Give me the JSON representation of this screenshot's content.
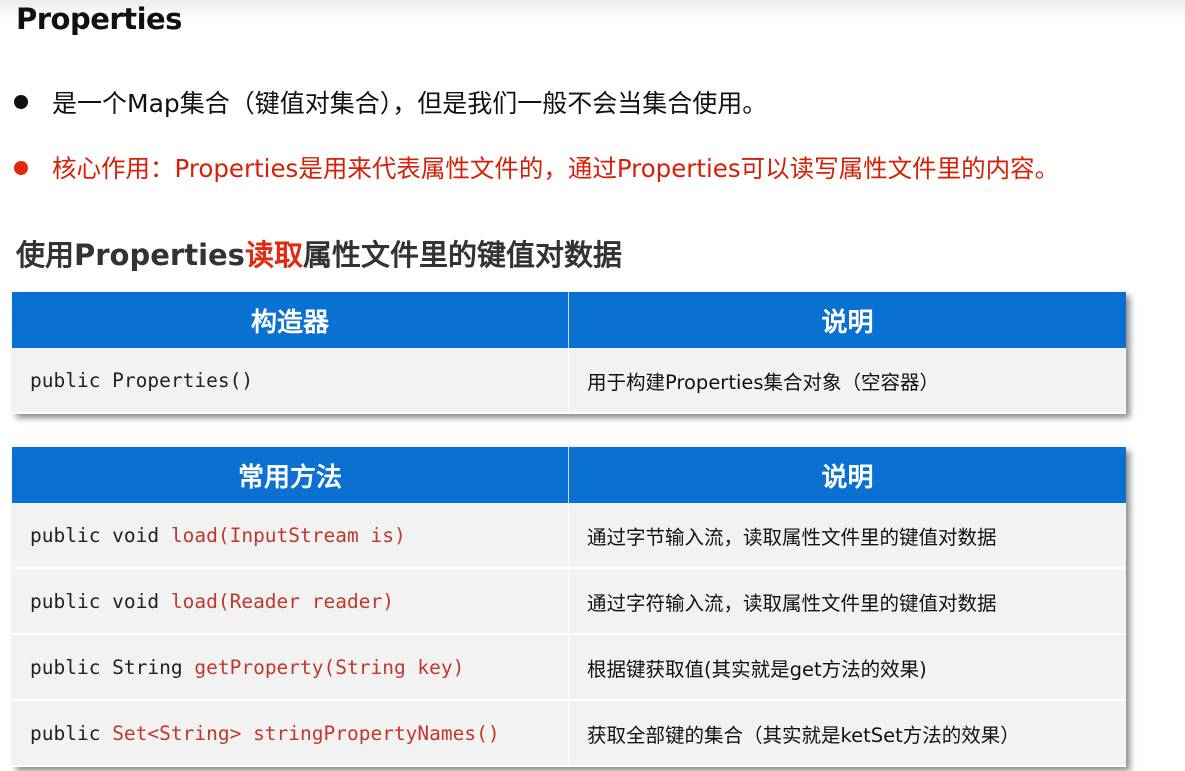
{
  "title": "Properties",
  "bullets": [
    "是一个Map集合（键值对集合），但是我们一般不会当集合使用。",
    "核心作用：Properties是用来代表属性文件的，通过Properties可以读写属性文件里的内容。"
  ],
  "subtitle": {
    "prefix": "使用Properties",
    "highlight": "读取",
    "suffix": "属性文件里的键值对数据"
  },
  "constructor_table": {
    "headers": [
      "构造器",
      "说明"
    ],
    "rows": [
      {
        "code_plain": "public Properties()",
        "code_hl": "",
        "desc": "用于构建Properties集合对象（空容器）"
      }
    ]
  },
  "method_table": {
    "headers": [
      "常用方法",
      "说明"
    ],
    "rows": [
      {
        "code_plain": "public void ",
        "code_hl": "load(InputStream is)",
        "desc": "通过字节输入流，读取属性文件里的键值对数据"
      },
      {
        "code_plain": "public void ",
        "code_hl": "load(Reader reader)",
        "desc": "通过字符输入流，读取属性文件里的键值对数据"
      },
      {
        "code_plain": "public String ",
        "code_hl": "getProperty(String key)",
        "desc": "根据键获取值(其实就是get方法的效果)"
      },
      {
        "code_plain": "public ",
        "code_hl": "Set<String> stringPropertyNames()",
        "desc": "获取全部键的集合（其实就是ketSet方法的效果）"
      }
    ]
  },
  "colors": {
    "header_blue": "#0a70d1",
    "accent_red": "#e02a10",
    "row_bg": "#f2f2f2"
  }
}
